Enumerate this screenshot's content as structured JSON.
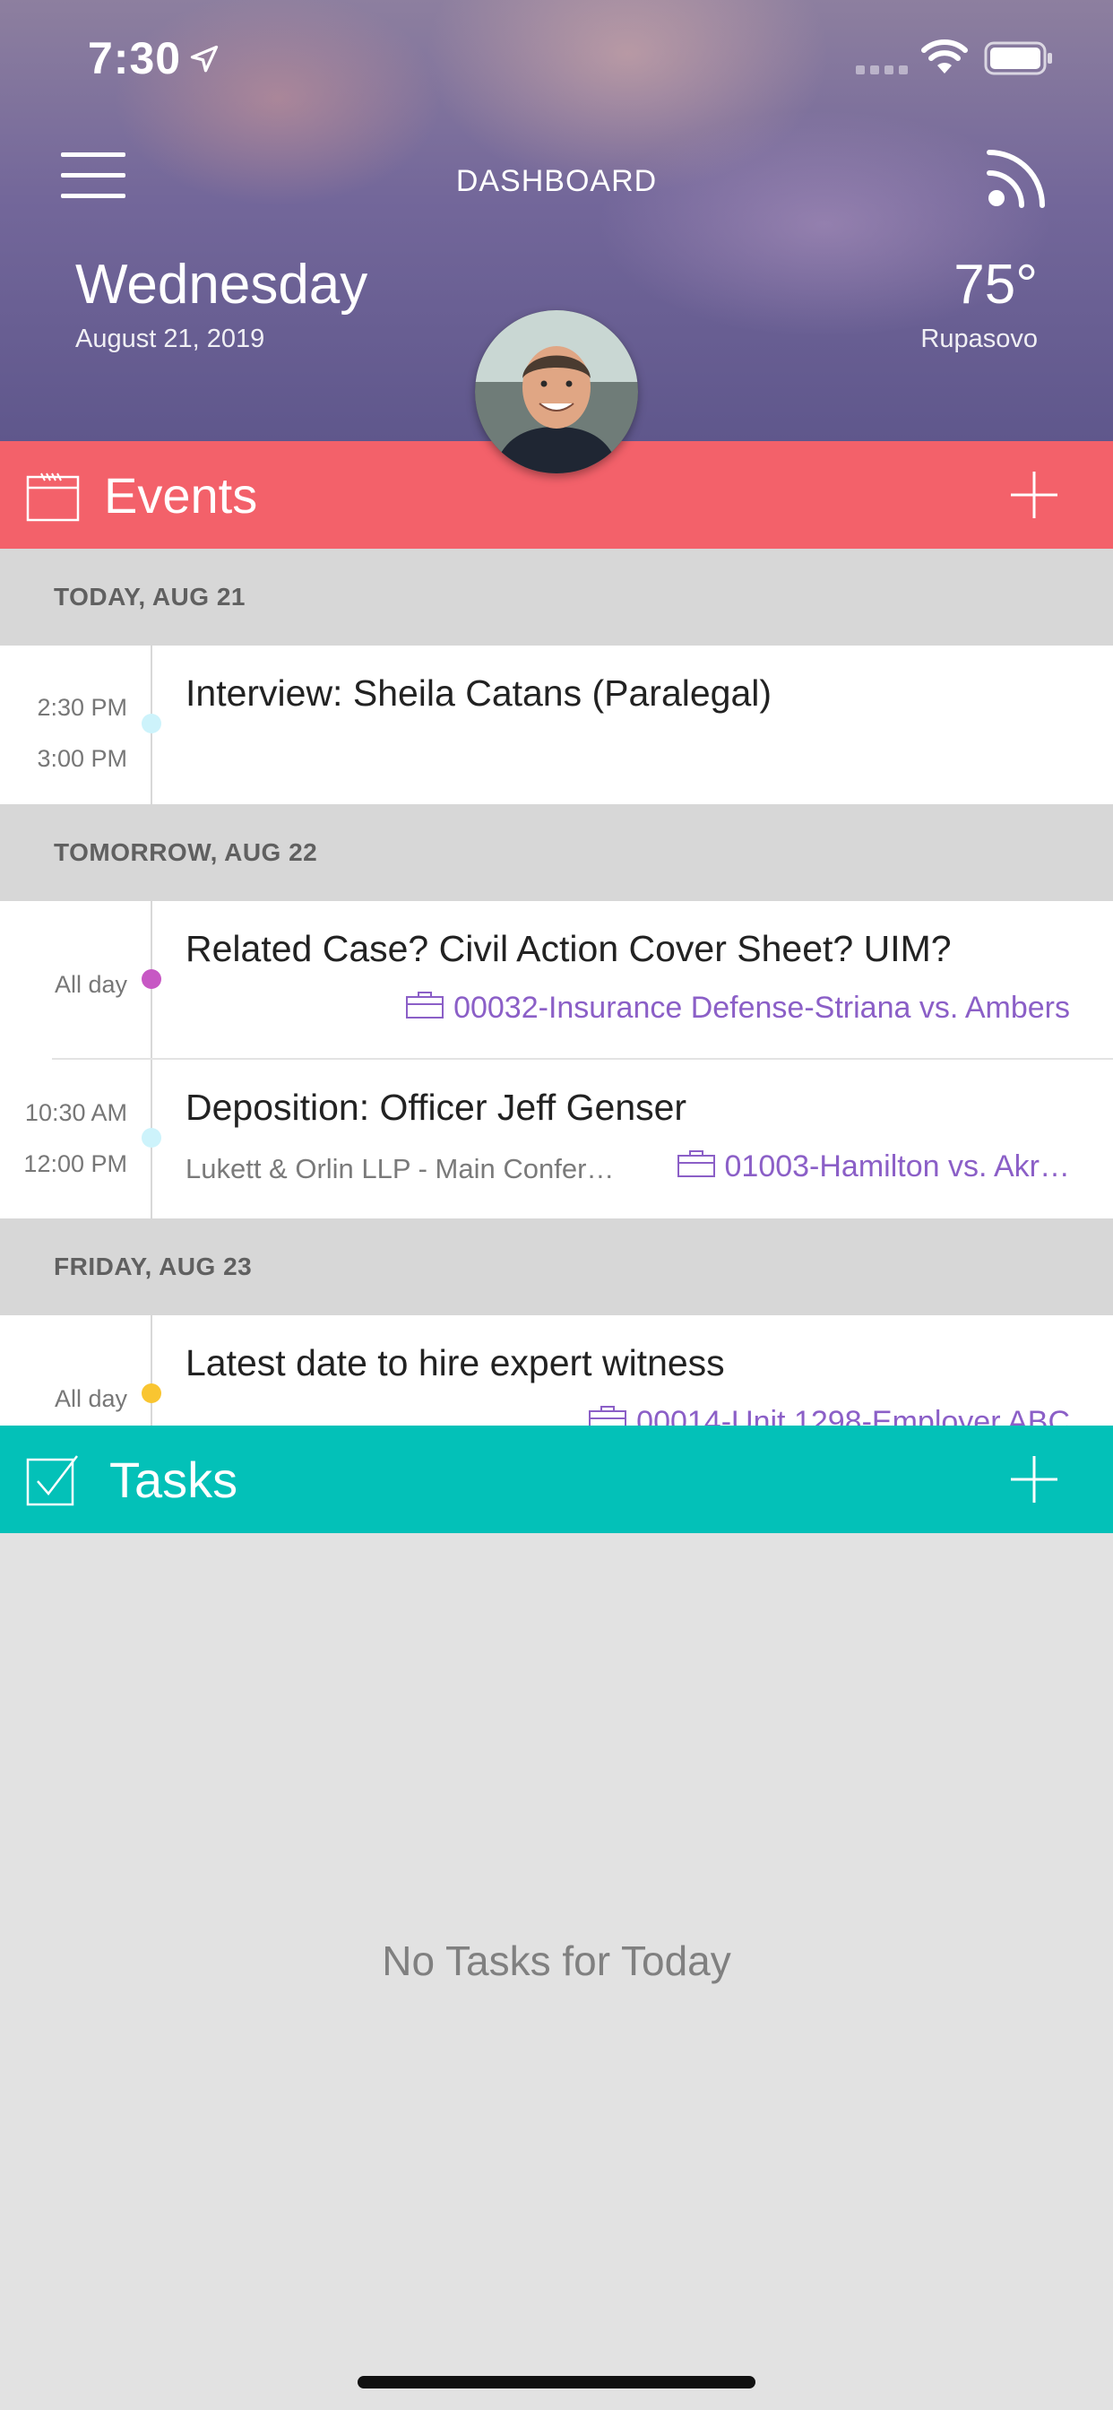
{
  "status_bar": {
    "time": "7:30"
  },
  "header": {
    "title": "DASHBOARD",
    "day": "Wednesday",
    "date": "August 21, 2019",
    "temperature": "75°",
    "location": "Rupasovo"
  },
  "events": {
    "title": "Events",
    "groups": [
      {
        "header": "TODAY, AUG 21",
        "items": [
          {
            "start": "2:30 PM",
            "end": "3:00 PM",
            "title": "Interview: Sheila Catans (Paralegal)",
            "dot_color": "#cdf3fb"
          }
        ]
      },
      {
        "header": "TOMORROW, AUG 22",
        "items": [
          {
            "all_day": "All day",
            "title": "Related Case? Civil Action Cover Sheet? UIM?",
            "matter": "00032-Insurance Defense-Striana vs. Ambers",
            "dot_color": "#c758c4"
          },
          {
            "start": "10:30 AM",
            "end": "12:00 PM",
            "title": "Deposition: Officer Jeff Genser",
            "location": "Lukett & Orlin LLP - Main Confer…",
            "matter": "01003-Hamilton vs. Akr…",
            "dot_color": "#cdf3fb"
          }
        ]
      },
      {
        "header": "FRIDAY, AUG 23",
        "items": [
          {
            "all_day": "All day",
            "title": "Latest date to hire expert witness",
            "matter": "00014-Unit 1298-Employer ABC",
            "dot_color": "#f9c531"
          }
        ]
      }
    ]
  },
  "tasks": {
    "title": "Tasks",
    "empty_message": "No Tasks for Today"
  },
  "colors": {
    "events_bar": "#f3616a",
    "tasks_bar": "#03c1b8",
    "matter_link": "#8b5fc7"
  },
  "icons": {
    "status": [
      "location-arrow-icon",
      "signal-icon",
      "wifi-icon",
      "battery-icon"
    ],
    "header": [
      "hamburger-menu-icon",
      "rss-feed-icon"
    ],
    "events_bar": [
      "calendar-icon",
      "plus-icon"
    ],
    "tasks_bar": [
      "checkbox-icon",
      "plus-icon"
    ],
    "matter": "briefcase-icon"
  }
}
